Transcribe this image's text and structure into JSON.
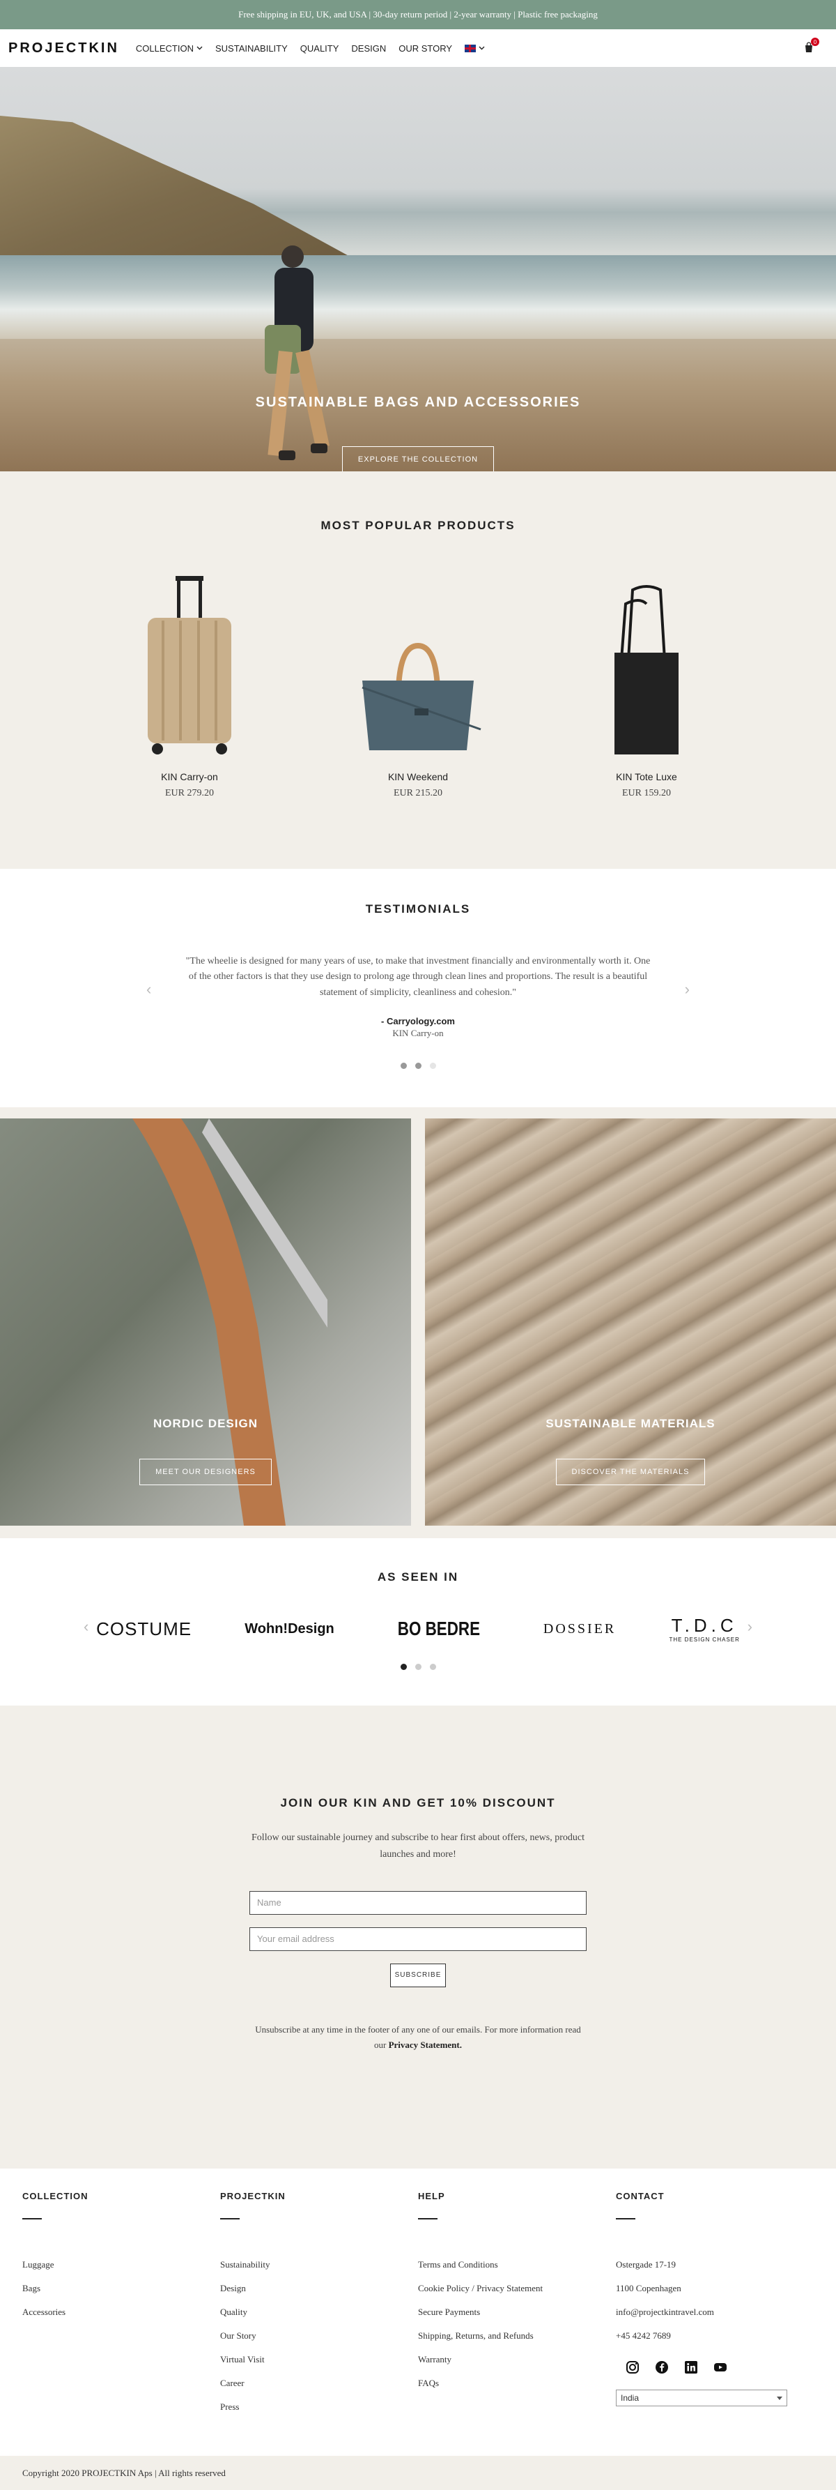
{
  "announcement": "Free shipping in EU, UK, and USA  |  30-day return period  |  2-year warranty  |  Plastic free packaging",
  "header": {
    "logo": "PROJECTKIN",
    "nav": [
      "COLLECTION",
      "SUSTAINABILITY",
      "QUALITY",
      "DESIGN",
      "OUR STORY"
    ],
    "cart_count": "0"
  },
  "hero": {
    "title": "SUSTAINABLE BAGS AND ACCESSORIES",
    "button": "EXPLORE THE COLLECTION"
  },
  "popular": {
    "title": "MOST POPULAR PRODUCTS",
    "products": [
      {
        "name": "KIN Carry-on",
        "price": "EUR 279.20"
      },
      {
        "name": "KIN Weekend",
        "price": "EUR 215.20"
      },
      {
        "name": "KIN Tote Luxe",
        "price": "EUR 159.20"
      }
    ]
  },
  "testimonials": {
    "title": "TESTIMONIALS",
    "quote": "\"The wheelie is designed for many years of use, to make that investment financially and environmentally worth it. One of the other factors is that they use design to prolong age through clean lines and proportions. The result is a beautiful statement of simplicity, cleanliness and cohesion.\"",
    "author": "- Carryology.com",
    "product": "KIN Carry-on",
    "prev": "‹",
    "next": "›"
  },
  "features": {
    "left": {
      "title": "NORDIC DESIGN",
      "button": "MEET OUR DESIGNERS"
    },
    "right": {
      "title": "SUSTAINABLE MATERIALS",
      "button": "DISCOVER THE MATERIALS"
    }
  },
  "seen": {
    "title": "AS SEEN IN",
    "logos": [
      "COSTUME",
      "Wohn!Design",
      "BO BEDRE",
      "DOSSIER",
      "T.D.C"
    ],
    "tdc_sub": "THE DESIGN CHASER",
    "prev": "‹",
    "next": "›"
  },
  "newsletter": {
    "title": "JOIN OUR KIN AND GET 10% DISCOUNT",
    "text": "Follow our sustainable journey and subscribe to hear first about offers, news, product launches and more!",
    "name_placeholder": "Name",
    "email_placeholder": "Your email address",
    "button": "SUBSCRIBE",
    "note": "Unsubscribe at any time in the footer of any one of our emails. For more information read our",
    "note_link": "Privacy Statement."
  },
  "footer": {
    "columns": [
      {
        "title": "COLLECTION",
        "links": [
          "Luggage",
          "Bags",
          "Accessories"
        ]
      },
      {
        "title": "PROJECTKIN",
        "links": [
          "Sustainability",
          "Design",
          "Quality",
          "Our Story",
          "Virtual Visit",
          "Career",
          "Press"
        ]
      },
      {
        "title": "HELP",
        "links": [
          "Terms and Conditions",
          "Cookie Policy / Privacy Statement",
          "Secure Payments",
          "Shipping, Returns, and Refunds",
          "Warranty",
          "FAQs"
        ]
      },
      {
        "title": "CONTACT",
        "links": [
          "Ostergade 17-19",
          "1100 Copenhagen",
          "info@projectkintravel.com",
          "+45 4242 7689"
        ]
      }
    ],
    "country": "India",
    "copyright": "Copyright 2020 PROJECTKIN Aps | All rights reserved"
  },
  "colors": {
    "accent": "#7a9a88",
    "beige": "#f2efe9"
  },
  "icons": [
    "chevron-down-icon",
    "uk-flag-icon",
    "cart-icon",
    "instagram-icon",
    "facebook-icon",
    "linkedin-icon",
    "youtube-icon"
  ]
}
